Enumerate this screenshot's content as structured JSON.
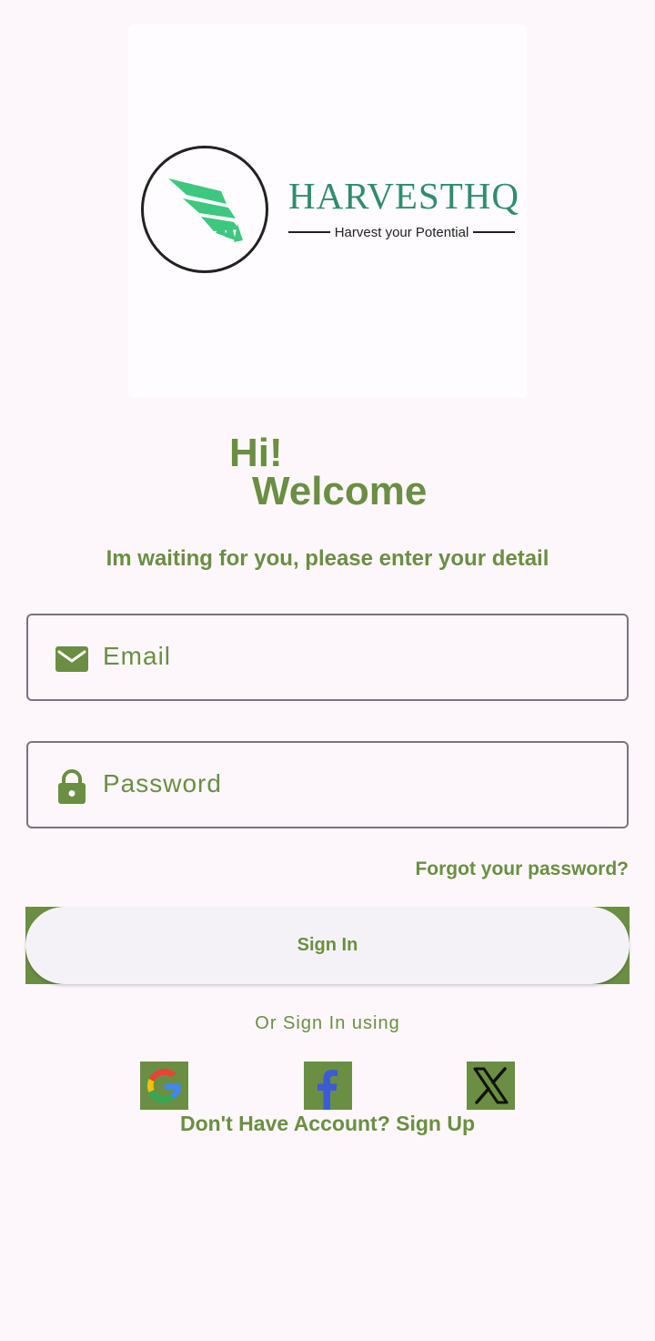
{
  "logo": {
    "brand_name": "HARVESTHQ",
    "tagline": "Harvest your Potential"
  },
  "greeting": {
    "hi": "Hi!",
    "welcome": "Welcome",
    "subtitle": "Im waiting for you, please enter your detail"
  },
  "form": {
    "email_placeholder": "Email",
    "password_placeholder": "Password",
    "forgot_link": "Forgot your password?",
    "signin_label": "Sign In"
  },
  "social": {
    "or_text": "Or Sign In using",
    "icons": [
      "google-icon",
      "facebook-icon",
      "x-icon"
    ]
  },
  "signup": {
    "text": "Don't Have Account? Sign Up"
  },
  "colors": {
    "accent": "#6a8f42",
    "brand_teal": "#2f8c70",
    "wing_green": "#3dc77f",
    "background": "#fdf7fb",
    "field_border": "#79747e"
  }
}
